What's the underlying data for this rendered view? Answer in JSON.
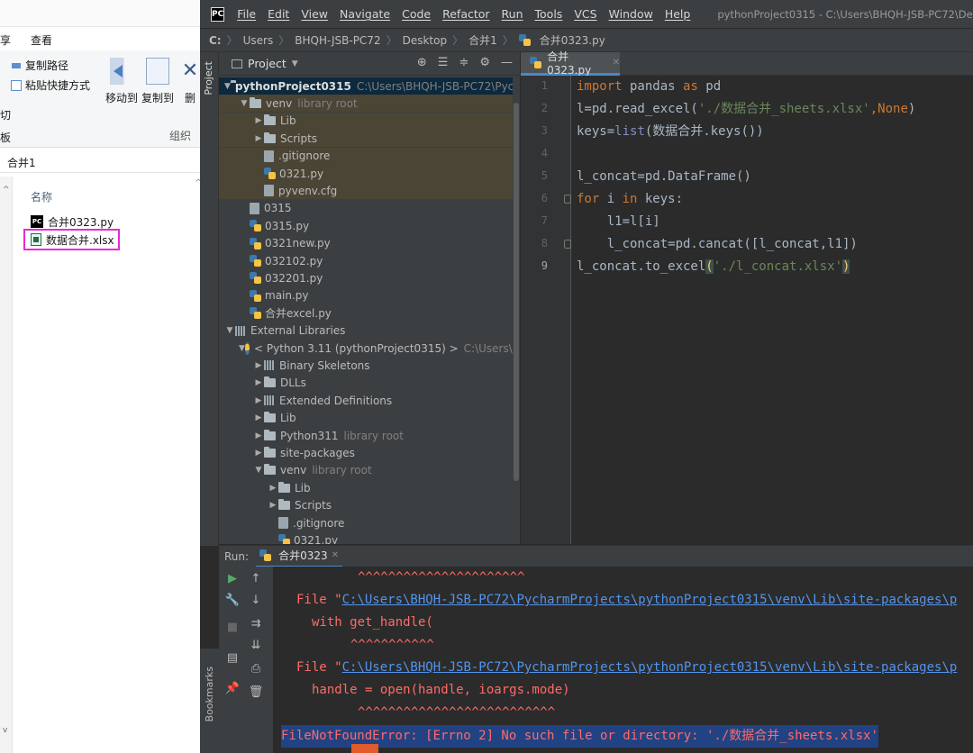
{
  "explorer": {
    "tab_partial": "享",
    "tab_view": "查看",
    "copy_path": "复制路径",
    "paste_shortcut": "粘贴快捷方式",
    "cut_partial": "切",
    "board_partial": "板",
    "move_to": "移动到",
    "copy_to": "复制到",
    "delete_partial": "删",
    "organize": "组织",
    "address": "合并1",
    "column_name": "名称",
    "files": [
      {
        "name": "合并0323.py",
        "icon": "pycharm-file-icon"
      },
      {
        "name": "数据合并.xlsx",
        "icon": "excel-file-icon"
      }
    ]
  },
  "pycharm": {
    "menu": [
      "File",
      "Edit",
      "View",
      "Navigate",
      "Code",
      "Refactor",
      "Run",
      "Tools",
      "VCS",
      "Window",
      "Help"
    ],
    "window_title": "pythonProject0315 - C:\\Users\\BHQH-JSB-PC72\\Desktop\\合",
    "breadcrumb": [
      "C:",
      "Users",
      "BHQH-JSB-PC72",
      "Desktop",
      "合并1",
      "合并0323.py"
    ],
    "project_label": "Project",
    "side_project": "Project",
    "side_bookmarks": "Bookmarks",
    "tree": [
      {
        "label": "pythonProject0315",
        "hint": "C:\\Users\\BHQH-JSB-PC72\\Pych",
        "type": "root"
      },
      {
        "label": "venv",
        "hint": "library root",
        "type": "folder"
      },
      {
        "label": "Lib",
        "hint": "",
        "type": "folder"
      },
      {
        "label": "Scripts",
        "hint": "",
        "type": "folder"
      },
      {
        "label": ".gitignore",
        "hint": "",
        "type": "file"
      },
      {
        "label": "0321.py",
        "hint": "",
        "type": "py"
      },
      {
        "label": "pyvenv.cfg",
        "hint": "",
        "type": "file"
      },
      {
        "label": "0315",
        "hint": "",
        "type": "file"
      },
      {
        "label": "0315.py",
        "hint": "",
        "type": "py"
      },
      {
        "label": "0321new.py",
        "hint": "",
        "type": "py"
      },
      {
        "label": "032102.py",
        "hint": "",
        "type": "py"
      },
      {
        "label": "032201.py",
        "hint": "",
        "type": "py"
      },
      {
        "label": "main.py",
        "hint": "",
        "type": "py"
      },
      {
        "label": "合并excel.py",
        "hint": "",
        "type": "py"
      },
      {
        "label": "External Libraries",
        "hint": "",
        "type": "lib"
      },
      {
        "label": "< Python 3.11 (pythonProject0315) >",
        "hint": "C:\\Users\\B",
        "type": "pyenv"
      },
      {
        "label": "Binary Skeletons",
        "hint": "",
        "type": "lib"
      },
      {
        "label": "DLLs",
        "hint": "",
        "type": "folder"
      },
      {
        "label": "Extended Definitions",
        "hint": "",
        "type": "lib"
      },
      {
        "label": "Lib",
        "hint": "",
        "type": "folder"
      },
      {
        "label": "Python311",
        "hint": "library root",
        "type": "folder"
      },
      {
        "label": "site-packages",
        "hint": "",
        "type": "folder"
      },
      {
        "label": "venv",
        "hint": "library root",
        "type": "folder"
      },
      {
        "label": "Lib",
        "hint": "",
        "type": "folder"
      },
      {
        "label": "Scripts",
        "hint": "",
        "type": "folder"
      },
      {
        "label": ".gitignore",
        "hint": "",
        "type": "file"
      },
      {
        "label": "0321.py",
        "hint": "",
        "type": "py"
      }
    ],
    "editor_tab": "合并0323.py",
    "line_numbers": [
      "1",
      "2",
      "3",
      "4",
      "5",
      "6",
      "7",
      "8",
      "9"
    ],
    "code": {
      "l1_import": "import",
      "l1_mod": " pandas ",
      "l1_as": "as",
      "l1_pd": " pd",
      "l2_a": "l=pd.read_excel(",
      "l2_str": "'./数据合并_sheets.xlsx'",
      "l2_b": ",",
      "l2_none": "None",
      "l2_c": ")",
      "l3_a": "keys=",
      "l3_list": "list",
      "l3_b": "(数据合并.keys())",
      "l5": "l_concat=pd.DataFrame()",
      "l6_for": "for",
      "l6_a": " i ",
      "l6_in": "in",
      "l6_b": " keys:",
      "l7": "    l1=l[i]",
      "l8": "    l_concat=pd.cancat([l_concat,l1])",
      "l9_a": "l_concat.to_excel",
      "l9_p1": "(",
      "l9_str": "'./l_concat.xlsx'",
      "l9_p2": ")"
    },
    "run_label": "Run:",
    "run_tab": "合并0323",
    "console": {
      "carets1": "^^^^^^^^^^^^^^^^^^^^^^",
      "file1_prefix": "File \"",
      "file1_link": "C:\\Users\\BHQH-JSB-PC72\\PycharmProjects\\pythonProject0315\\venv\\Lib\\site-packages\\p",
      "with_line": "with get_handle(",
      "carets2": "^^^^^^^^^^^",
      "file2_prefix": "File \"",
      "file2_link": "C:\\Users\\BHQH-JSB-PC72\\PycharmProjects\\pythonProject0315\\venv\\Lib\\site-packages\\p",
      "handle_line": "handle = open(handle, ioargs.mode)",
      "carets3": "^^^^^^^^^^^^^^^^^^^^^^^^^^",
      "error": "FileNotFoundError: [Errno 2] No such file or directory: './数据合并_sheets.xlsx'"
    }
  }
}
